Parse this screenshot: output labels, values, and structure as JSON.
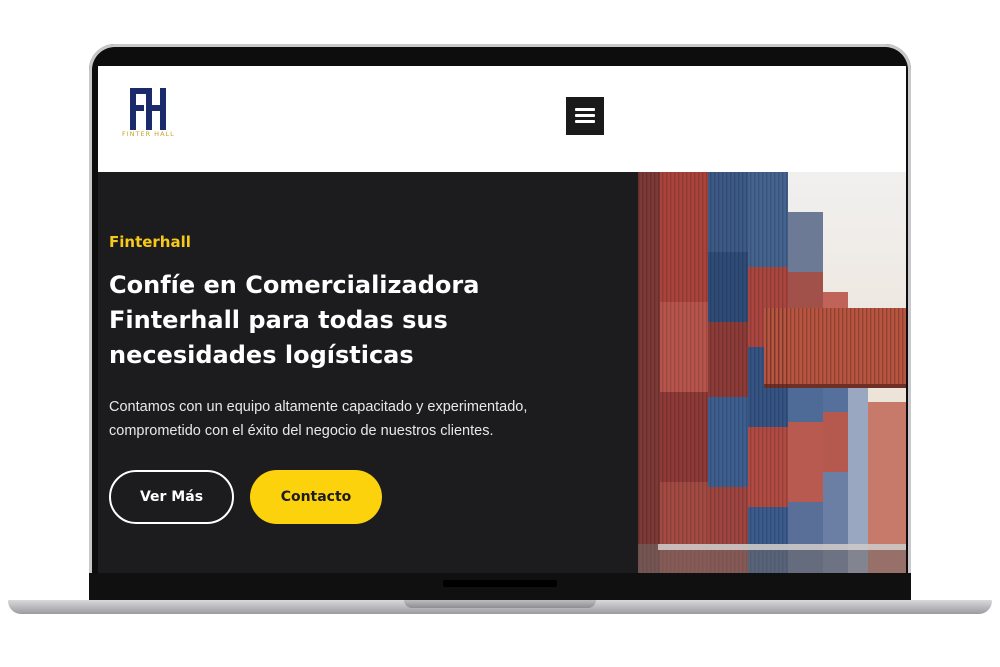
{
  "logo": {
    "monogram": "FH",
    "caption": "FINTER HALL"
  },
  "header": {
    "menu_icon": "hamburger-menu-icon"
  },
  "hero": {
    "eyebrow": "Finterhall",
    "headline": "Confíe en Comercializadora Finterhall para todas sus necesidades logísticas",
    "paragraph": "Contamos con un equipo altamente capacitado y experimentado, comprometido con el éxito del negocio de nuestros clientes.",
    "primary_button": "Ver Más",
    "secondary_button": "Contacto",
    "image": "shipping-containers-photo"
  },
  "colors": {
    "accent": "#fcd20c",
    "eyebrow": "#f7c91a",
    "hero_bg": "#1c1c1e",
    "logo_navy": "#1b2a6b",
    "logo_gold": "#c9a227"
  }
}
